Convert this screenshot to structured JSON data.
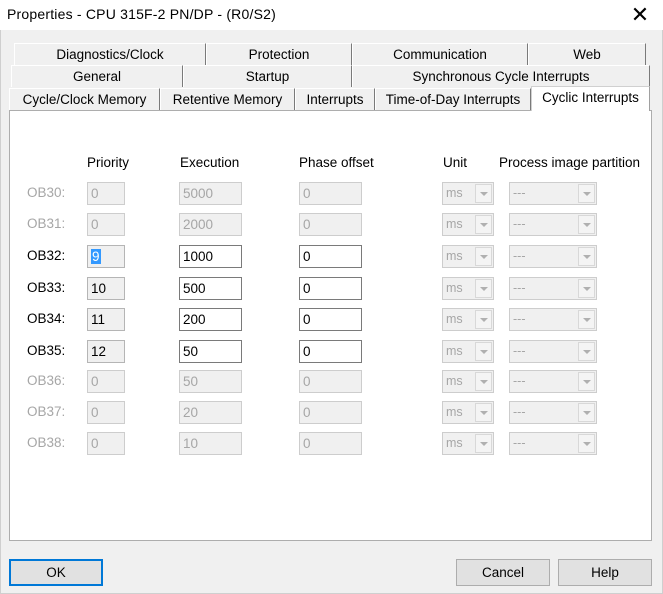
{
  "window": {
    "title": "Properties - CPU 315F-2 PN/DP - (R0/S2)",
    "close_glyph": "✕"
  },
  "tabs": {
    "row1": [
      "Diagnostics/Clock",
      "Protection",
      "Communication",
      "Web"
    ],
    "row2": [
      "General",
      "Startup",
      "Synchronous Cycle Interrupts"
    ],
    "row3": [
      "Cycle/Clock Memory",
      "Retentive Memory",
      "Interrupts",
      "Time-of-Day Interrupts",
      "Cyclic Interrupts"
    ],
    "active": "Cyclic Interrupts"
  },
  "columns": {
    "priority": "Priority",
    "execution": "Execution",
    "phase_offset": "Phase offset",
    "unit": "Unit",
    "process_image_partition": "Process image partition"
  },
  "rows": [
    {
      "ob": "OB30:",
      "priority": "0",
      "execution": "5000",
      "phase": "0",
      "unit": "ms",
      "pip": "---",
      "enabled": false
    },
    {
      "ob": "OB31:",
      "priority": "0",
      "execution": "2000",
      "phase": "0",
      "unit": "ms",
      "pip": "---",
      "enabled": false
    },
    {
      "ob": "OB32:",
      "priority": "9",
      "execution": "1000",
      "phase": "0",
      "unit": "ms",
      "pip": "---",
      "enabled": true
    },
    {
      "ob": "OB33:",
      "priority": "10",
      "execution": "500",
      "phase": "0",
      "unit": "ms",
      "pip": "---",
      "enabled": true
    },
    {
      "ob": "OB34:",
      "priority": "11",
      "execution": "200",
      "phase": "0",
      "unit": "ms",
      "pip": "---",
      "enabled": true
    },
    {
      "ob": "OB35:",
      "priority": "12",
      "execution": "50",
      "phase": "0",
      "unit": "ms",
      "pip": "---",
      "enabled": true
    },
    {
      "ob": "OB36:",
      "priority": "0",
      "execution": "50",
      "phase": "0",
      "unit": "ms",
      "pip": "---",
      "enabled": false
    },
    {
      "ob": "OB37:",
      "priority": "0",
      "execution": "20",
      "phase": "0",
      "unit": "ms",
      "pip": "---",
      "enabled": false
    },
    {
      "ob": "OB38:",
      "priority": "0",
      "execution": "10",
      "phase": "0",
      "unit": "ms",
      "pip": "---",
      "enabled": false
    }
  ],
  "buttons": {
    "ok": "OK",
    "cancel": "Cancel",
    "help": "Help"
  },
  "colors": {
    "selection": "#3399ff",
    "disabled_text": "#a6a6a6"
  }
}
